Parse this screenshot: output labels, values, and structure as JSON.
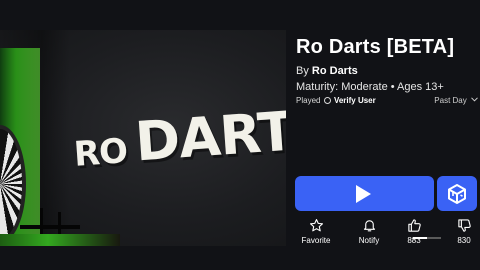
{
  "game": {
    "title": "Ro Darts [BETA]",
    "creator_prefix": "By",
    "creator_name": "Ro Darts",
    "maturity": "Maturity: Moderate • Ages 13+",
    "played_label": "Played",
    "verify_label": "Verify User",
    "period_label": "Past Day",
    "thumbnail_logo_line1": "RO",
    "thumbnail_logo_line2": "DARTS"
  },
  "actions": {
    "favorite_label": "Favorite",
    "notify_label": "Notify",
    "upvotes": "883",
    "downvotes": "830",
    "upvote_ratio": 0.5155
  },
  "colors": {
    "background": "#111216",
    "play_button": "#3a62f5",
    "text": "#ffffff"
  },
  "icons": {
    "play": "play-icon",
    "party": "party-cube-icon",
    "favorite": "star-icon",
    "notify": "bell-icon",
    "upvote": "thumbs-up-icon",
    "downvote": "thumbs-down-icon",
    "clock": "clock-icon",
    "chevron": "chevron-down-icon"
  }
}
